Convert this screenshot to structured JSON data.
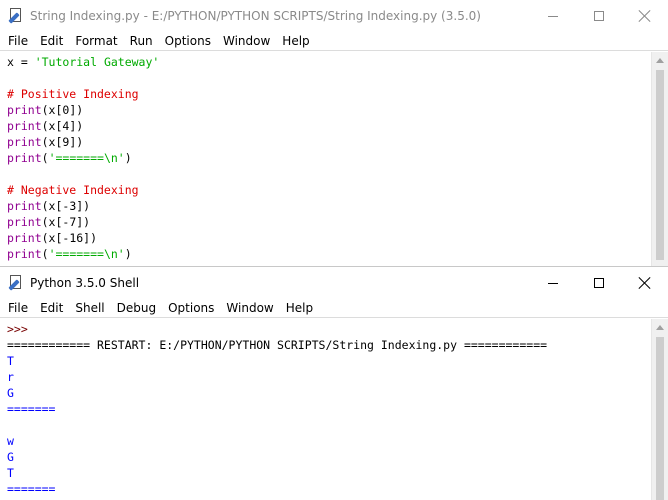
{
  "editor": {
    "title": "String Indexing.py - E:/PYTHON/PYTHON SCRIPTS/String Indexing.py (3.5.0)",
    "menu": [
      "File",
      "Edit",
      "Format",
      "Run",
      "Options",
      "Window",
      "Help"
    ],
    "code": {
      "assign_lhs": "x = ",
      "assign_str": "'Tutorial Gateway'",
      "comment_positive": "# Positive Indexing",
      "comment_negative": "# Negative Indexing",
      "print_kw": "print",
      "positive": [
        "(x[0])",
        "(x[4])",
        "(x[9])"
      ],
      "negative": [
        "(x[-3])",
        "(x[-7])",
        "(x[-16])"
      ],
      "sep_open": "(",
      "sep_str": "'=======\\n'",
      "sep_close": ")"
    }
  },
  "shell": {
    "title": "Python 3.5.0 Shell",
    "menu": [
      "File",
      "Edit",
      "Shell",
      "Debug",
      "Options",
      "Window",
      "Help"
    ],
    "prompt": ">>>",
    "restart": "============ RESTART: E:/PYTHON/PYTHON SCRIPTS/String Indexing.py ============",
    "output": [
      "T",
      "r",
      "G",
      "=======",
      "",
      "w",
      "G",
      "T",
      "======="
    ]
  },
  "icons": {
    "app": "idle-file-icon",
    "minimize": "minimize-icon",
    "maximize": "maximize-icon",
    "close": "close-icon"
  },
  "colors": {
    "keyword": "#900090",
    "string": "#00aa00",
    "comment": "#dd0000",
    "output": "#0000ff",
    "prompt": "#770000"
  }
}
